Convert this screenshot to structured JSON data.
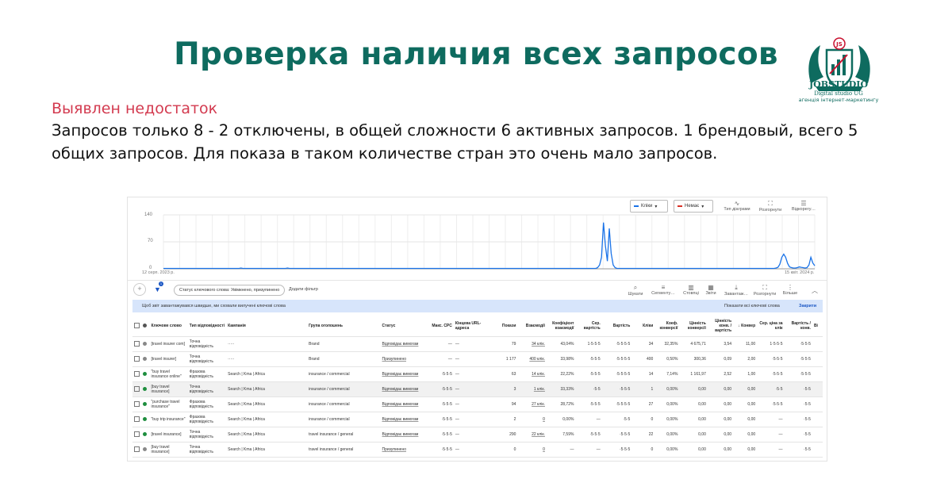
{
  "slide": {
    "title": "Проверка наличия всех запросов",
    "issue_label": "Выявлен недостаток",
    "issue_text": "Запросов только 8 - 2 отключены, в общей сложности 6 активных запросов. 1 брендовый, всего 5 общих запросов. Для показа в таком количестве стран это очень мало запросов."
  },
  "logo": {
    "brand": "JOBSTUDIO",
    "line1": "Digital studio UG",
    "line2": "агенція інтернет-маркетингу",
    "colors": {
      "teal": "#0e6b5f",
      "red": "#c8102e"
    }
  },
  "chart": {
    "metric1": "Кліки",
    "metric2": "Немає",
    "metric1_color": "#1a73e8",
    "metric2_color": "#d93025",
    "toolbar": [
      {
        "label": "Тип діаграми",
        "icon": "line-chart-icon"
      },
      {
        "label": "Розгорнути",
        "icon": "expand-icon"
      },
      {
        "label": "Відкорегу…",
        "icon": "adjust-icon"
      }
    ],
    "y_ticks": [
      "140",
      "70",
      "0"
    ],
    "x_start": "12 серп. 2023 р.",
    "x_end": "15 квіт. 2024 р."
  },
  "chart_data": {
    "type": "line",
    "series": [
      {
        "name": "Кліки",
        "color": "#1a73e8",
        "values": [
          1,
          1,
          1,
          1,
          1,
          1,
          1,
          1,
          1,
          1,
          1,
          1,
          1,
          1,
          1,
          1,
          1,
          1,
          1,
          1,
          1,
          1,
          1,
          1,
          1,
          1,
          1,
          1,
          1,
          1,
          1,
          1,
          1,
          1,
          1,
          1,
          1,
          1,
          1,
          1,
          2,
          1,
          1,
          1,
          1,
          1,
          1,
          1,
          1,
          1,
          1,
          1,
          1,
          1,
          1,
          1,
          1,
          1,
          1,
          1,
          1,
          1,
          1,
          1,
          2,
          1,
          1,
          1,
          1,
          1,
          1,
          1,
          1,
          1,
          1,
          1,
          1,
          1,
          1,
          1,
          1,
          1,
          1,
          1,
          1,
          1,
          1,
          1,
          1,
          1,
          1,
          1,
          1,
          1,
          1,
          1,
          1,
          1,
          1,
          1,
          1,
          1,
          1,
          1,
          1,
          1,
          1,
          1,
          1,
          1,
          1,
          1,
          1,
          1,
          1,
          1,
          1,
          1,
          1,
          1,
          1,
          1,
          1,
          1,
          1,
          1,
          1,
          1,
          1,
          1,
          1,
          1,
          1,
          1,
          1,
          1,
          1,
          1,
          1,
          1,
          1,
          1,
          1,
          1,
          1,
          1,
          1,
          1,
          1,
          1,
          1,
          1,
          1,
          1,
          1,
          1,
          1,
          1,
          1,
          1,
          1,
          1,
          1,
          1,
          1,
          1,
          1,
          1,
          1,
          1,
          1,
          1,
          1,
          1,
          1,
          1,
          1,
          1,
          1,
          1,
          1,
          1,
          1,
          1,
          1,
          1,
          1,
          1,
          1,
          1,
          1,
          1,
          1,
          1,
          1,
          1,
          1,
          1,
          1,
          1,
          1,
          1,
          1,
          1,
          1,
          1,
          1,
          1,
          1,
          1,
          1,
          1,
          1,
          1,
          1,
          1,
          1,
          1,
          1,
          1,
          1,
          1,
          1,
          1,
          3,
          10,
          30,
          120,
          60,
          20,
          105,
          40,
          10,
          3,
          1,
          1,
          1,
          1,
          1,
          1,
          1,
          1,
          1,
          1,
          1,
          1,
          1,
          1,
          1,
          1,
          1,
          1,
          1,
          1,
          1,
          1,
          1,
          1,
          1,
          1,
          1,
          1,
          1,
          1,
          1,
          1,
          1,
          1,
          1,
          1,
          1,
          1,
          1,
          1,
          1,
          1,
          1,
          1,
          1,
          1,
          1,
          1,
          1,
          1,
          1,
          1,
          1,
          1,
          1,
          1,
          1,
          1,
          1,
          1,
          1,
          1,
          1,
          1,
          1,
          1,
          1,
          1,
          1,
          1,
          1,
          1,
          1,
          1,
          1,
          1,
          1,
          1,
          1,
          1,
          1,
          1,
          2,
          4,
          12,
          30,
          38,
          30,
          14,
          5,
          3,
          2,
          2,
          3,
          5,
          4,
          3,
          2,
          3,
          10,
          30,
          15,
          8
        ]
      }
    ],
    "ylim": [
      0,
      140
    ],
    "x_range": [
      "12 серп. 2023 р.",
      "15 квіт. 2024 р."
    ],
    "grid": true
  },
  "filterbar": {
    "badge": "1",
    "chip": "Статус ключового слова: Увімкнено, призупинено",
    "add_filter": "Додати фільтр",
    "tools": [
      {
        "label": "Шукати",
        "icon": "search-icon"
      },
      {
        "label": "Сегменту…",
        "icon": "segment-icon"
      },
      {
        "label": "Стовпці",
        "icon": "columns-icon"
      },
      {
        "label": "Звіти",
        "icon": "reports-icon"
      },
      {
        "label": "Завантаж…",
        "icon": "download-icon"
      },
      {
        "label": "Розгорнути",
        "icon": "expand-icon"
      },
      {
        "label": "Більше",
        "icon": "more-icon"
      }
    ]
  },
  "banner": {
    "text": "Щоб звіт завантажувався швидше, ми сховали вилучені ключові слова",
    "show": "Показати всі ключові слова",
    "close": "Закрити"
  },
  "table": {
    "headers": [
      "Ключове слово",
      "Тип відповідності",
      "Кампанія",
      "Група оголошень",
      "Статус",
      "Макс. CPC",
      "Кінцева URL-адреса",
      "Покази",
      "Взаємодії",
      "Коефіцієнт взаємодії",
      "Сер. вартість",
      "Вартість",
      "Кліки",
      "Коеф. конверсії",
      "Цінність конверсії",
      "Цінність конв. / вартість",
      "↓ Конвер",
      "Сер. ціна за клік",
      "Вартість / конв.",
      "Ві"
    ],
    "rows": [
      {
        "status_color": "#888888",
        "kw": "[travel insurer com]",
        "match": "Точна відповідність",
        "campaign": "·····",
        "adgroup": "Brand",
        "status": "Відповідає вимогам",
        "cpc": "—",
        "url": "—",
        "impr": "79",
        "inter": "34 клік.",
        "ir": "43,04%",
        "avg": "1·5·5·5",
        "cost": "·5·5·5·5",
        "clicks": "34",
        "cr": "32,35%",
        "cv": "4 675,71",
        "cvc": "3,54",
        "conv": "11,00",
        "cpc2": "1·5·5·5",
        "cpa": "·5·5·5",
        "x": ""
      },
      {
        "status_color": "#888888",
        "kw": "[travel insurer]",
        "match": "Точна відповідність",
        "campaign": "·····",
        "adgroup": "Brand",
        "status": "Призупинено",
        "cpc": "—",
        "url": "—",
        "impr": "1 177",
        "inter": "400 клік.",
        "ir": "33,98%",
        "avg": "·5·5·5",
        "cost": "·5·5·5·5",
        "clicks": "400",
        "cr": "0,50%",
        "cv": "300,36",
        "cvc": "0,09",
        "conv": "2,00",
        "cpc2": "·5·5·5",
        "cpa": "·5·5·5",
        "x": ""
      },
      {
        "status_color": "#1e8e3e",
        "kw": "\"buy travel insurance online\"",
        "match": "Фразова відповідність",
        "campaign": "Search | Kma | Africa",
        "adgroup": "insurance / commercial",
        "status": "Відповідає вимогам",
        "cpc": "·5·5·5",
        "url": "—",
        "impr": "63",
        "inter": "14 клік.",
        "ir": "22,22%",
        "avg": "·5·5·5",
        "cost": "·5·5·5·5",
        "clicks": "14",
        "cr": "7,14%",
        "cv": "1 161,97",
        "cvc": "2,52",
        "conv": "1,00",
        "cpc2": "·5·5·5",
        "cpa": "·5·5·5",
        "x": ""
      },
      {
        "status_color": "#1e8e3e",
        "kw": "[buy travel insurance]",
        "match": "Точна відповідність",
        "campaign": "Search | Kma | Africa",
        "adgroup": "insurance / commercial",
        "status": "Відповідає вимогам",
        "cpc": "·5·5·5",
        "url": "—",
        "impr": "3",
        "inter": "1 клік.",
        "ir": "33,33%",
        "avg": "·5·5",
        "cost": "·5·5·5",
        "clicks": "1",
        "cr": "0,00%",
        "cv": "0,00",
        "cvc": "0,00",
        "conv": "0,00",
        "cpc2": "·5·5",
        "cpa": "·5·5",
        "x": ""
      },
      {
        "status_color": "#1e8e3e",
        "kw": "\"purchase travel insurance\"",
        "match": "Фразова відповідність",
        "campaign": "Search | Kma | Africa",
        "adgroup": "insurance / commercial",
        "status": "Відповідає вимогам",
        "cpc": "·5·5·5",
        "url": "—",
        "impr": "94",
        "inter": "27 клік.",
        "ir": "28,72%",
        "avg": "·5·5·5",
        "cost": "·5·5·5·5",
        "clicks": "27",
        "cr": "0,00%",
        "cv": "0,00",
        "cvc": "0,00",
        "conv": "0,00",
        "cpc2": "·5·5·5",
        "cpa": "·5·5",
        "x": ""
      },
      {
        "status_color": "#1e8e3e",
        "kw": "\"buy trip insurance\"",
        "match": "Фразова відповідність",
        "campaign": "Search | Kma | Africa",
        "adgroup": "insurance / commercial",
        "status": "Відповідає вимогам",
        "cpc": "·5·5·5",
        "url": "—",
        "impr": "2",
        "inter": "0",
        "ir": "0,00%",
        "avg": "—",
        "cost": "·5·5",
        "clicks": "0",
        "cr": "0,00%",
        "cv": "0,00",
        "cvc": "0,00",
        "conv": "0,00",
        "cpc2": "—",
        "cpa": "·5·5",
        "x": ""
      },
      {
        "status_color": "#1e8e3e",
        "kw": "[travel insurance]",
        "match": "Точна відповідність",
        "campaign": "Search | Kma | Africa",
        "adgroup": "travel insurance / general",
        "status": "Відповідає вимогам",
        "cpc": "·5·5·5",
        "url": "—",
        "impr": "290",
        "inter": "22 клік.",
        "ir": "7,59%",
        "avg": "·5·5·5",
        "cost": "·5·5·5",
        "clicks": "22",
        "cr": "0,00%",
        "cv": "0,00",
        "cvc": "0,00",
        "conv": "0,00",
        "cpc2": "—",
        "cpa": "·5·5",
        "x": ""
      },
      {
        "status_color": "#888888",
        "kw": "[buy travel insurance]",
        "match": "Точна відповідність",
        "campaign": "Search | Kma | Africa",
        "adgroup": "travel insurance / general",
        "status": "Призупинено",
        "cpc": "·5·5·5",
        "url": "—",
        "impr": "0",
        "inter": "0",
        "ir": "—",
        "avg": "—",
        "cost": "·5·5·5",
        "clicks": "0",
        "cr": "0,00%",
        "cv": "0,00",
        "cvc": "0,00",
        "conv": "0,00",
        "cpc2": "—",
        "cpa": "·5·5",
        "x": ""
      }
    ]
  }
}
